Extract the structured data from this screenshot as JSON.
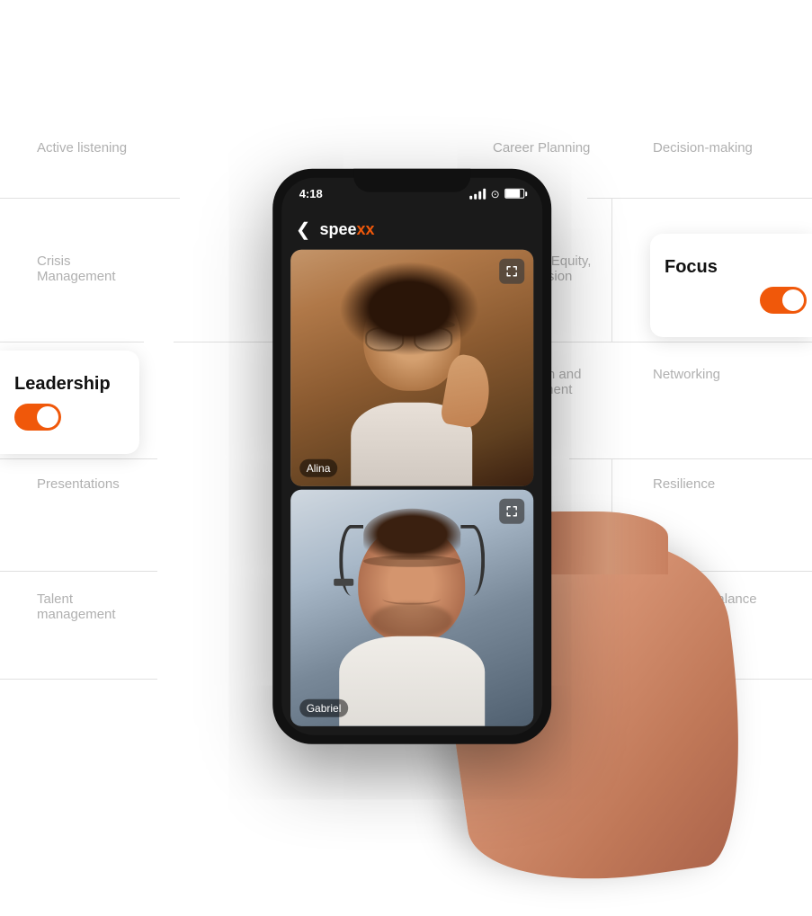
{
  "app": {
    "title": "speexx",
    "title_accent": "x"
  },
  "phone": {
    "status_bar": {
      "time": "4:18"
    },
    "nav": {
      "back_label": "‹",
      "title_plain": "spee",
      "title_accent": "xx"
    },
    "video": {
      "participant1": {
        "name": "Alina",
        "expand_icon": "⤢"
      },
      "participant2": {
        "name": "Gabriel",
        "expand_icon": "⤢"
      }
    }
  },
  "skills": {
    "active_listening": "Active listening",
    "career_planning": "Career Planning",
    "decision_making": "Decision-making",
    "crisis_management_line1": "Crisis",
    "crisis_management_line2": "Management",
    "diversity_line1": "Diversity, Equity,",
    "diversity_line2": "and Inclusion",
    "leadership": "Leadership",
    "innovation_line1": "Innovation and",
    "innovation_line2": "Development",
    "networking": "Networking",
    "presentations": "Presentations",
    "resilience": "Resilience",
    "talent_line1": "Talent",
    "talent_line2": "management",
    "work_life": "Work-life balance"
  },
  "cards": {
    "focus": {
      "title": "Focus",
      "toggle_state": true
    },
    "leadership": {
      "title": "Leadership",
      "toggle_state": true
    }
  },
  "colors": {
    "accent": "#f0580a",
    "text_muted": "#b0b0b0",
    "text_dark": "#111111",
    "card_bg": "#ffffff"
  }
}
